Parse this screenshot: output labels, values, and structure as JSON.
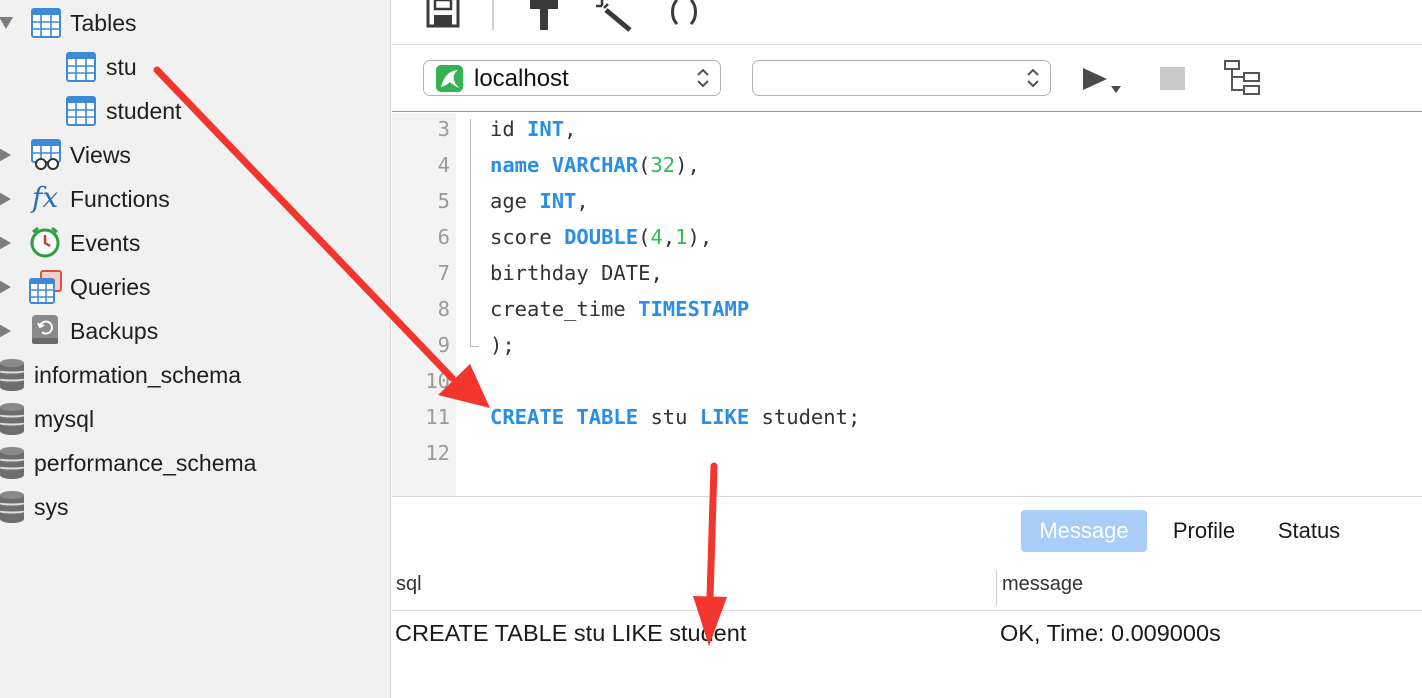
{
  "sidebar": {
    "items": [
      {
        "label": "Tables"
      },
      {
        "label": "stu"
      },
      {
        "label": "student"
      },
      {
        "label": "Views"
      },
      {
        "label": "Functions"
      },
      {
        "label": "Events"
      },
      {
        "label": "Queries"
      },
      {
        "label": "Backups"
      },
      {
        "label": "information_schema"
      },
      {
        "label": "mysql"
      },
      {
        "label": "performance_schema"
      },
      {
        "label": "sys"
      }
    ],
    "functions_glyph": "fx"
  },
  "toolbar": {
    "icons": [
      "save-icon",
      "build-hammer-icon",
      "magic-wand-icon",
      "parentheses-icon"
    ]
  },
  "connection": {
    "host_value": "localhost",
    "database_value": "",
    "icons": [
      "run-icon",
      "stop-icon",
      "explain-icon"
    ]
  },
  "editor": {
    "lines": [
      {
        "num": "3",
        "tokens": [
          {
            "t": "id "
          },
          {
            "t": "INT",
            "c": "kw"
          },
          {
            "t": ","
          }
        ]
      },
      {
        "num": "4",
        "tokens": [
          {
            "t": "name",
            "c": "kw"
          },
          {
            "t": " "
          },
          {
            "t": "VARCHAR",
            "c": "kw"
          },
          {
            "t": "("
          },
          {
            "t": "32",
            "c": "num"
          },
          {
            "t": "),"
          }
        ]
      },
      {
        "num": "5",
        "tokens": [
          {
            "t": "age "
          },
          {
            "t": "INT",
            "c": "kw"
          },
          {
            "t": ","
          }
        ]
      },
      {
        "num": "6",
        "tokens": [
          {
            "t": "score "
          },
          {
            "t": "DOUBLE",
            "c": "kw"
          },
          {
            "t": "("
          },
          {
            "t": "4",
            "c": "num"
          },
          {
            "t": ","
          },
          {
            "t": "1",
            "c": "num"
          },
          {
            "t": "),"
          }
        ]
      },
      {
        "num": "7",
        "tokens": [
          {
            "t": "birthday DATE,"
          }
        ]
      },
      {
        "num": "8",
        "tokens": [
          {
            "t": "create_time "
          },
          {
            "t": "TIMESTAMP",
            "c": "kw"
          }
        ]
      },
      {
        "num": "9",
        "tokens": [
          {
            "t": ");"
          }
        ]
      },
      {
        "num": "10",
        "tokens": []
      },
      {
        "num": "11",
        "tokens": [
          {
            "t": "CREATE",
            "c": "kw"
          },
          {
            "t": " "
          },
          {
            "t": "TABLE",
            "c": "kw"
          },
          {
            "t": " stu "
          },
          {
            "t": "LIKE",
            "c": "kw"
          },
          {
            "t": " student;"
          }
        ]
      },
      {
        "num": "12",
        "tokens": []
      }
    ]
  },
  "results": {
    "tabs": [
      {
        "label": "Message",
        "active": true
      },
      {
        "label": "Profile",
        "active": false
      },
      {
        "label": "Status",
        "active": false
      }
    ],
    "columns": [
      "sql",
      "message"
    ],
    "rows": [
      {
        "sql": "CREATE TABLE stu LIKE student",
        "message": "OK, Time: 0.009000s"
      }
    ]
  },
  "colors": {
    "keyword": "#2a8ee6",
    "number": "#2ebd58",
    "active_tab": "#a9cdf7",
    "arrow": "#f2352d"
  }
}
